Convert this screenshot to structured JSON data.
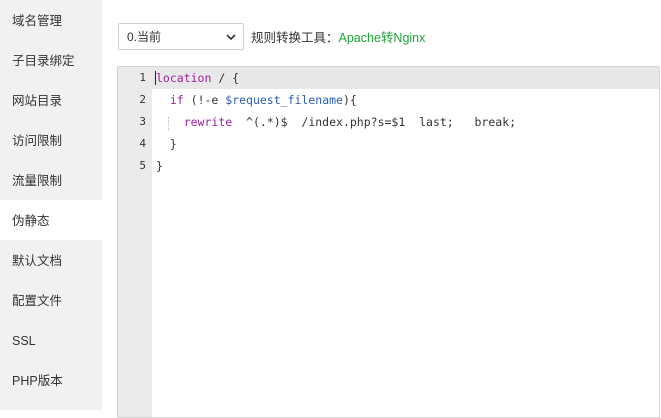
{
  "sidebar": {
    "items": [
      {
        "label": "域名管理"
      },
      {
        "label": "子目录绑定"
      },
      {
        "label": "网站目录"
      },
      {
        "label": "访问限制"
      },
      {
        "label": "流量限制"
      },
      {
        "label": "伪静态",
        "active": true
      },
      {
        "label": "默认文档"
      },
      {
        "label": "配置文件"
      },
      {
        "label": "SSL"
      },
      {
        "label": "PHP版本"
      }
    ]
  },
  "toolbar": {
    "template_select": {
      "value": "0.当前"
    },
    "label": "规则转换工具：",
    "link": "Apache转Nginx"
  },
  "editor": {
    "line_numbers": [
      "1",
      "2",
      "3",
      "4",
      "5"
    ],
    "lines": [
      {
        "tokens": [
          {
            "t": "location",
            "c": "kw"
          },
          {
            "t": " / {"
          }
        ]
      },
      {
        "tokens": [
          {
            "t": "  "
          },
          {
            "t": "if",
            "c": "kw"
          },
          {
            "t": " (!-e "
          },
          {
            "t": "$request_filename",
            "c": "var"
          },
          {
            "t": "){"
          }
        ]
      },
      {
        "tokens": [
          {
            "t": "    "
          },
          {
            "t": "rewrite",
            "c": "kw"
          },
          {
            "t": "  ^(.*)$  /index.php?s=$1  last;   break;"
          }
        ]
      },
      {
        "tokens": [
          {
            "t": "  }"
          }
        ]
      },
      {
        "tokens": [
          {
            "t": "}"
          }
        ]
      }
    ]
  },
  "colors": {
    "accent_green": "#20a53a",
    "keyword": "#a020a0",
    "variable": "#2a5db0",
    "sidebar_bg": "#f1f1f1"
  }
}
